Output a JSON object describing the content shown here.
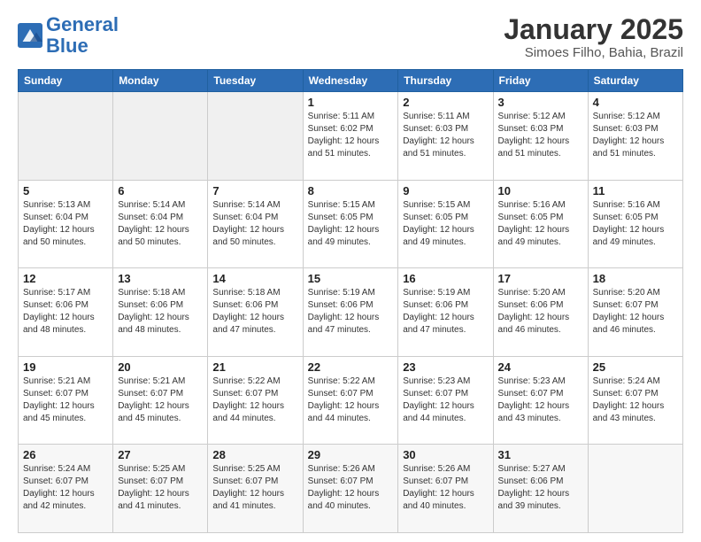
{
  "logo": {
    "line1": "General",
    "line2": "Blue"
  },
  "title": "January 2025",
  "subtitle": "Simoes Filho, Bahia, Brazil",
  "days_of_week": [
    "Sunday",
    "Monday",
    "Tuesday",
    "Wednesday",
    "Thursday",
    "Friday",
    "Saturday"
  ],
  "weeks": [
    [
      {
        "day": "",
        "info": ""
      },
      {
        "day": "",
        "info": ""
      },
      {
        "day": "",
        "info": ""
      },
      {
        "day": "1",
        "info": "Sunrise: 5:11 AM\nSunset: 6:02 PM\nDaylight: 12 hours\nand 51 minutes."
      },
      {
        "day": "2",
        "info": "Sunrise: 5:11 AM\nSunset: 6:03 PM\nDaylight: 12 hours\nand 51 minutes."
      },
      {
        "day": "3",
        "info": "Sunrise: 5:12 AM\nSunset: 6:03 PM\nDaylight: 12 hours\nand 51 minutes."
      },
      {
        "day": "4",
        "info": "Sunrise: 5:12 AM\nSunset: 6:03 PM\nDaylight: 12 hours\nand 51 minutes."
      }
    ],
    [
      {
        "day": "5",
        "info": "Sunrise: 5:13 AM\nSunset: 6:04 PM\nDaylight: 12 hours\nand 50 minutes."
      },
      {
        "day": "6",
        "info": "Sunrise: 5:14 AM\nSunset: 6:04 PM\nDaylight: 12 hours\nand 50 minutes."
      },
      {
        "day": "7",
        "info": "Sunrise: 5:14 AM\nSunset: 6:04 PM\nDaylight: 12 hours\nand 50 minutes."
      },
      {
        "day": "8",
        "info": "Sunrise: 5:15 AM\nSunset: 6:05 PM\nDaylight: 12 hours\nand 49 minutes."
      },
      {
        "day": "9",
        "info": "Sunrise: 5:15 AM\nSunset: 6:05 PM\nDaylight: 12 hours\nand 49 minutes."
      },
      {
        "day": "10",
        "info": "Sunrise: 5:16 AM\nSunset: 6:05 PM\nDaylight: 12 hours\nand 49 minutes."
      },
      {
        "day": "11",
        "info": "Sunrise: 5:16 AM\nSunset: 6:05 PM\nDaylight: 12 hours\nand 49 minutes."
      }
    ],
    [
      {
        "day": "12",
        "info": "Sunrise: 5:17 AM\nSunset: 6:06 PM\nDaylight: 12 hours\nand 48 minutes."
      },
      {
        "day": "13",
        "info": "Sunrise: 5:18 AM\nSunset: 6:06 PM\nDaylight: 12 hours\nand 48 minutes."
      },
      {
        "day": "14",
        "info": "Sunrise: 5:18 AM\nSunset: 6:06 PM\nDaylight: 12 hours\nand 47 minutes."
      },
      {
        "day": "15",
        "info": "Sunrise: 5:19 AM\nSunset: 6:06 PM\nDaylight: 12 hours\nand 47 minutes."
      },
      {
        "day": "16",
        "info": "Sunrise: 5:19 AM\nSunset: 6:06 PM\nDaylight: 12 hours\nand 47 minutes."
      },
      {
        "day": "17",
        "info": "Sunrise: 5:20 AM\nSunset: 6:06 PM\nDaylight: 12 hours\nand 46 minutes."
      },
      {
        "day": "18",
        "info": "Sunrise: 5:20 AM\nSunset: 6:07 PM\nDaylight: 12 hours\nand 46 minutes."
      }
    ],
    [
      {
        "day": "19",
        "info": "Sunrise: 5:21 AM\nSunset: 6:07 PM\nDaylight: 12 hours\nand 45 minutes."
      },
      {
        "day": "20",
        "info": "Sunrise: 5:21 AM\nSunset: 6:07 PM\nDaylight: 12 hours\nand 45 minutes."
      },
      {
        "day": "21",
        "info": "Sunrise: 5:22 AM\nSunset: 6:07 PM\nDaylight: 12 hours\nand 44 minutes."
      },
      {
        "day": "22",
        "info": "Sunrise: 5:22 AM\nSunset: 6:07 PM\nDaylight: 12 hours\nand 44 minutes."
      },
      {
        "day": "23",
        "info": "Sunrise: 5:23 AM\nSunset: 6:07 PM\nDaylight: 12 hours\nand 44 minutes."
      },
      {
        "day": "24",
        "info": "Sunrise: 5:23 AM\nSunset: 6:07 PM\nDaylight: 12 hours\nand 43 minutes."
      },
      {
        "day": "25",
        "info": "Sunrise: 5:24 AM\nSunset: 6:07 PM\nDaylight: 12 hours\nand 43 minutes."
      }
    ],
    [
      {
        "day": "26",
        "info": "Sunrise: 5:24 AM\nSunset: 6:07 PM\nDaylight: 12 hours\nand 42 minutes."
      },
      {
        "day": "27",
        "info": "Sunrise: 5:25 AM\nSunset: 6:07 PM\nDaylight: 12 hours\nand 41 minutes."
      },
      {
        "day": "28",
        "info": "Sunrise: 5:25 AM\nSunset: 6:07 PM\nDaylight: 12 hours\nand 41 minutes."
      },
      {
        "day": "29",
        "info": "Sunrise: 5:26 AM\nSunset: 6:07 PM\nDaylight: 12 hours\nand 40 minutes."
      },
      {
        "day": "30",
        "info": "Sunrise: 5:26 AM\nSunset: 6:07 PM\nDaylight: 12 hours\nand 40 minutes."
      },
      {
        "day": "31",
        "info": "Sunrise: 5:27 AM\nSunset: 6:06 PM\nDaylight: 12 hours\nand 39 minutes."
      },
      {
        "day": "",
        "info": ""
      }
    ]
  ]
}
